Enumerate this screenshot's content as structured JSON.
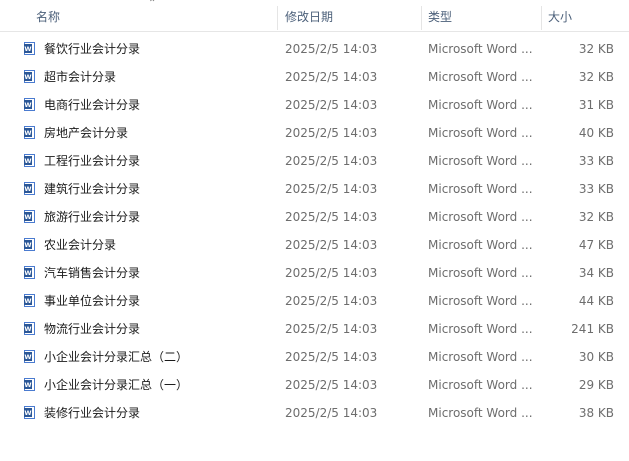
{
  "columns": {
    "name": "名称",
    "date": "修改日期",
    "type": "类型",
    "size": "大小"
  },
  "files": [
    {
      "name": "餐饮行业会计分录",
      "date": "2025/2/5 14:03",
      "type": "Microsoft Word ...",
      "size": "32 KB"
    },
    {
      "name": "超市会计分录",
      "date": "2025/2/5 14:03",
      "type": "Microsoft Word ...",
      "size": "32 KB"
    },
    {
      "name": "电商行业会计分录",
      "date": "2025/2/5 14:03",
      "type": "Microsoft Word ...",
      "size": "31 KB"
    },
    {
      "name": "房地产会计分录",
      "date": "2025/2/5 14:03",
      "type": "Microsoft Word ...",
      "size": "40 KB"
    },
    {
      "name": "工程行业会计分录",
      "date": "2025/2/5 14:03",
      "type": "Microsoft Word ...",
      "size": "33 KB"
    },
    {
      "name": "建筑行业会计分录",
      "date": "2025/2/5 14:03",
      "type": "Microsoft Word ...",
      "size": "33 KB"
    },
    {
      "name": "旅游行业会计分录",
      "date": "2025/2/5 14:03",
      "type": "Microsoft Word ...",
      "size": "32 KB"
    },
    {
      "name": "农业会计分录",
      "date": "2025/2/5 14:03",
      "type": "Microsoft Word ...",
      "size": "47 KB"
    },
    {
      "name": "汽车销售会计分录",
      "date": "2025/2/5 14:03",
      "type": "Microsoft Word ...",
      "size": "34 KB"
    },
    {
      "name": "事业单位会计分录",
      "date": "2025/2/5 14:03",
      "type": "Microsoft Word ...",
      "size": "44 KB"
    },
    {
      "name": "物流行业会计分录",
      "date": "2025/2/5 14:03",
      "type": "Microsoft Word ...",
      "size": "241 KB"
    },
    {
      "name": "小企业会计分录汇总（二）",
      "date": "2025/2/5 14:03",
      "type": "Microsoft Word ...",
      "size": "30 KB"
    },
    {
      "name": "小企业会计分录汇总（一）",
      "date": "2025/2/5 14:03",
      "type": "Microsoft Word ...",
      "size": "29 KB"
    },
    {
      "name": "装修行业会计分录",
      "date": "2025/2/5 14:03",
      "type": "Microsoft Word ...",
      "size": "38 KB"
    }
  ],
  "icons": {
    "file": "word-document-icon",
    "sort": "sort-up-chevron-icon"
  },
  "colors": {
    "word_blue": "#2b5797",
    "word_blue_light": "#4a7bd0",
    "header_text": "#4c607a"
  }
}
